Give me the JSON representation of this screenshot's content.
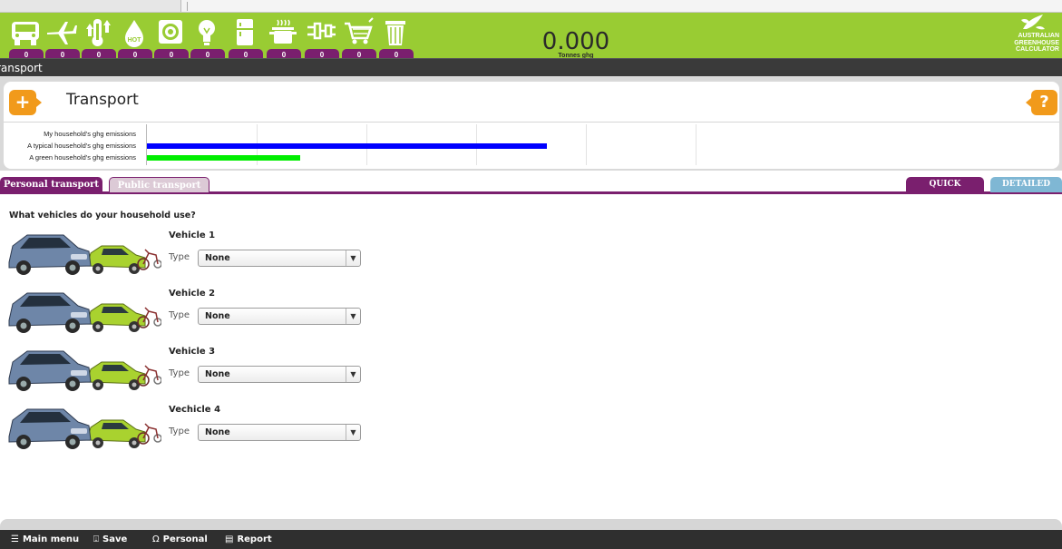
{
  "header": {
    "categories": [
      {
        "icon": "car-icon",
        "value": "0"
      },
      {
        "icon": "plane-icon",
        "value": "0"
      },
      {
        "icon": "thermometer-icon",
        "value": "0"
      },
      {
        "icon": "hot-water-drop-icon",
        "value": "0"
      },
      {
        "icon": "washing-machine-icon",
        "value": "0"
      },
      {
        "icon": "light-bulb-icon",
        "value": "0"
      },
      {
        "icon": "fridge-icon",
        "value": "0"
      },
      {
        "icon": "cooking-pot-icon",
        "value": "0"
      },
      {
        "icon": "power-plug-icon",
        "value": "0"
      },
      {
        "icon": "shopping-cart-icon",
        "value": "0"
      },
      {
        "icon": "rubbish-bin-icon",
        "value": "0"
      }
    ],
    "total_value": "0.000",
    "total_unit": "Tonnes ghg",
    "brand_lines": [
      "AUSTRALIAN",
      "GREENHOUSE",
      "CALCULATOR"
    ],
    "subbar_text": "ransport",
    "accent_green": "#99cc33",
    "accent_purple": "#7a1f6e"
  },
  "section": {
    "title": "Transport",
    "add_icon": "plus-icon",
    "add_label": "+",
    "help_label": "?"
  },
  "emissions": [
    {
      "label": "My household's ghg emissions",
      "value": 0,
      "color": "#0000ff"
    },
    {
      "label": "A typical household's ghg emissions",
      "value": 0.6,
      "color": "#0000ff"
    },
    {
      "label": "A green household's ghg emissions",
      "value": 0.23,
      "color": "#00ee00"
    }
  ],
  "tabs": {
    "personal": "Personal transport",
    "public": "Public transport",
    "quick": "QUICK",
    "detailed": "DETAILED"
  },
  "question": "What vehicles do your household use?",
  "vehicles": [
    {
      "title": "Vehicle 1",
      "type_label": "Type",
      "type_value": "None"
    },
    {
      "title": "Vehicle 2",
      "type_label": "Type",
      "type_value": "None"
    },
    {
      "title": "Vehicle 3",
      "type_label": "Type",
      "type_value": "None"
    },
    {
      "title": "Vechicle 4",
      "type_label": "Type",
      "type_value": "None"
    }
  ],
  "footer": {
    "main_menu": "Main menu",
    "save": "Save",
    "personal": "Personal",
    "report": "Report"
  }
}
